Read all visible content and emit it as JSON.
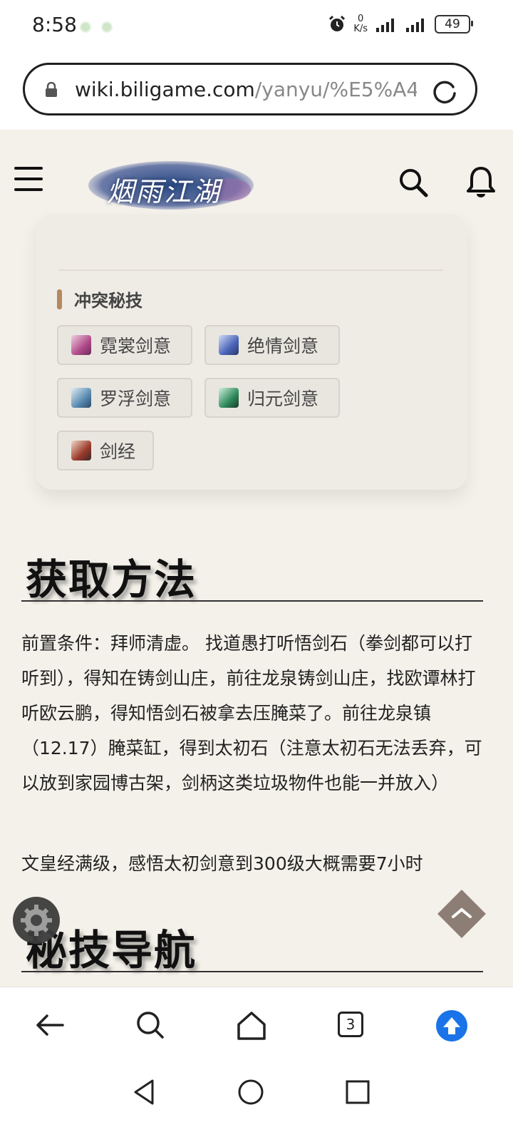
{
  "status_bar": {
    "time": "8:58",
    "net_speed_value": "0",
    "net_speed_unit": "K/s",
    "battery": "49"
  },
  "browser": {
    "url_domain": "wiki.biligame.com",
    "url_path": "/yanyu/%E5%A4",
    "tab_count": "3"
  },
  "site": {
    "logo_text": "烟雨江湖"
  },
  "card": {
    "title": "冲突秘技",
    "items": [
      {
        "label": "霓裳剑意",
        "icon_color": "#b04a8a"
      },
      {
        "label": "绝情剑意",
        "icon_color": "#4a64b8"
      },
      {
        "label": "罗浮剑意",
        "icon_color": "#5a8ab0"
      },
      {
        "label": "归元剑意",
        "icon_color": "#2e8a5a"
      },
      {
        "label": "剑经",
        "icon_color": "#9a3a2a"
      }
    ]
  },
  "content": {
    "section1_title": "获取方法",
    "paragraph1": "前置条件：拜师清虚。 找道愚打听悟剑石（拳剑都可以打听到），得知在铸剑山庄，前往龙泉铸剑山庄，找欧谭林打听欧云鹏，得知悟剑石被拿去压腌菜了。前往龙泉镇（12.17）腌菜缸，得到太初石（注意太初石无法丢弃，可以放到家园博古架，剑柄这类垃圾物件也能一并放入）",
    "paragraph2": "文皇经满级，感悟太初剑意到300级大概需要7小时",
    "section2_title": "秘技导航"
  },
  "colors": {
    "accent": "#b38a5e",
    "page_bg": "#f4f1ea",
    "browser_accent": "#1a73e8"
  }
}
